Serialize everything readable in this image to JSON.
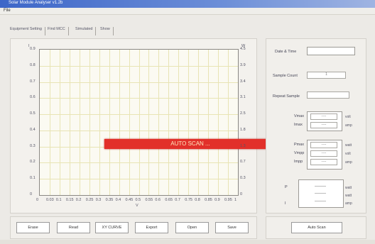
{
  "window": {
    "title": "Solar Module Analyser v1.2b"
  },
  "menu": {
    "file_label": "File"
  },
  "tabs": [
    "Equipment Setting",
    "Find MCC",
    "Simulated",
    "Show"
  ],
  "plot": {
    "y_left_ticks": [
      "0.9",
      "0.8",
      "0.7",
      "0.6",
      "0.5",
      "0.4",
      "0.3",
      "0.2",
      "0.1",
      "0"
    ],
    "y_right_ticks": [
      "4.5",
      "3.9",
      "3.4",
      "3.1",
      "2.5",
      "1.8",
      "1.3",
      "0.7",
      "0.3",
      "0"
    ],
    "x_ticks": [
      "0",
      "0.03",
      "0.1",
      "0.15",
      "0.2",
      "0.25",
      "0.3",
      "0.35",
      "0.4",
      "0.45",
      "0.5",
      "0.55",
      "0.6",
      "0.65",
      "0.7",
      "0.75",
      "0.8",
      "0.85",
      "0.9",
      "0.95",
      "1"
    ],
    "x_axis_label": "V",
    "y_left_axis_label": "I",
    "y_right_axis_label": "W"
  },
  "banner": {
    "text": "AUTO SCAN ..."
  },
  "side": {
    "date_time_label": "Date & Time",
    "sample_count_label": "Sample Count",
    "sample_count_value": "1",
    "repeat_sample_label": "Repeat Sample",
    "vmax_label": "Vmax",
    "imax_label": "Imax",
    "vmax_value": "----",
    "imax_value": "----",
    "pmax_label": "Pmax",
    "vmpp_label": "Vmpp",
    "impp_label": "Impp",
    "pmax_value": "----",
    "vmpp_value": "----",
    "impp_value": "----",
    "units": [
      "volt",
      "amp",
      "watt",
      "volt",
      "amp"
    ],
    "lower_units": [
      "watt",
      "watt",
      "amp"
    ],
    "lower_left_labels": [
      "P",
      "I"
    ]
  },
  "buttons": [
    "Erase",
    "Read",
    "XY CURVE",
    "Export",
    "Open",
    "Save"
  ],
  "auto_scan_button": "Auto Scan",
  "colors": {
    "banner": "#e2302a",
    "title": "#3d66c8"
  }
}
